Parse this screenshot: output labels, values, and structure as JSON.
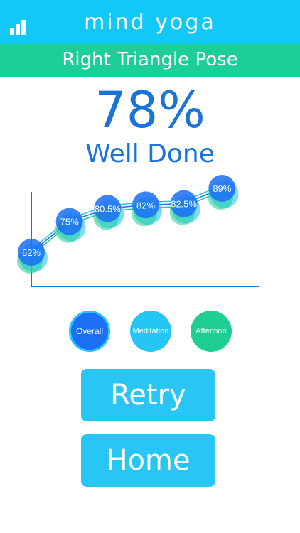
{
  "header": {
    "app_title": "mind yoga",
    "stats_icon": "bar-chart-icon",
    "bg_color": "#11c8f7"
  },
  "pose": {
    "title": "Right Triangle Pose",
    "bg_color": "#1dcf97"
  },
  "result": {
    "score": "78%",
    "message": "Well Done"
  },
  "chart_data": {
    "type": "scatter",
    "title": "",
    "xlabel": "",
    "ylabel": "",
    "series": [
      {
        "values": [
          62,
          75,
          80.5,
          82,
          82.5,
          89
        ],
        "labels": [
          "62%",
          "75%",
          "80.5%",
          "82%",
          "82.5%",
          "89%"
        ]
      }
    ],
    "ylim": [
      50,
      95
    ],
    "grid": false
  },
  "filters": {
    "overall": "Overall",
    "meditation": "Meditation",
    "attention": "Attention"
  },
  "actions": {
    "retry": "Retry",
    "home": "Home"
  },
  "colors": {
    "accent_blue": "#1a6ff5",
    "light_blue": "#25c5f5",
    "green": "#1fce94",
    "text_blue": "#1a73d6"
  }
}
